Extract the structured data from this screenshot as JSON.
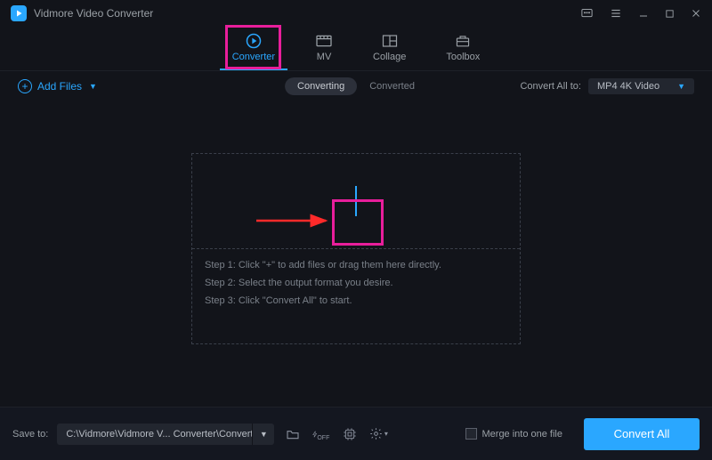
{
  "app": {
    "title": "Vidmore Video Converter"
  },
  "tabs": {
    "converter": "Converter",
    "mv": "MV",
    "collage": "Collage",
    "toolbox": "Toolbox"
  },
  "toolbar": {
    "add_files": "Add Files",
    "converting": "Converting",
    "converted": "Converted",
    "convert_all_to_label": "Convert All to:",
    "format_selected": "MP4 4K Video"
  },
  "dropzone": {
    "step1": "Step 1: Click \"+\" to add files or drag them here directly.",
    "step2": "Step 2: Select the output format you desire.",
    "step3": "Step 3: Click \"Convert All\" to start."
  },
  "bottom": {
    "save_to_label": "Save to:",
    "save_path": "C:\\Vidmore\\Vidmore V... Converter\\Converted",
    "merge_label": "Merge into one file",
    "convert_all_btn": "Convert All"
  }
}
